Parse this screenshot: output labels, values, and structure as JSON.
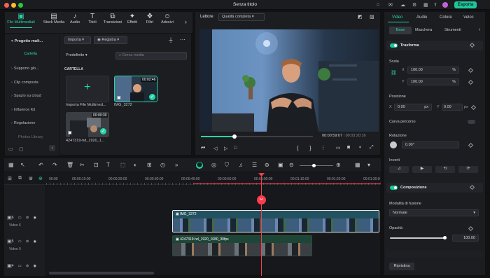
{
  "window": {
    "title": "Senza titolo",
    "export_label": "Esporta"
  },
  "toolbar_tabs": [
    {
      "label": "File Multimediali",
      "icon": "media-icon"
    },
    {
      "label": "Stock Media",
      "icon": "stock-media-icon"
    },
    {
      "label": "Audio",
      "icon": "music-note-icon"
    },
    {
      "label": "Titoli",
      "icon": "titles-icon"
    },
    {
      "label": "Transizioni",
      "icon": "transitions-icon"
    },
    {
      "label": "Effetti",
      "icon": "effects-icon"
    },
    {
      "label": "Filtri",
      "icon": "filters-icon"
    },
    {
      "label": "Adesivi",
      "icon": "stickers-icon"
    }
  ],
  "sidebar": {
    "items": [
      "Progetto mult...",
      "Cartella",
      "Supporto glo...",
      "Clip composta",
      "Spazio su cloud",
      "Influence Kit",
      "Regolazione",
      "Photos Library"
    ]
  },
  "media": {
    "import_label": "Importa",
    "record_label": "Registra",
    "sort_label": "Predefinito",
    "search_placeholder": "Cerca media",
    "folder_label": "CARTELLA",
    "items": [
      {
        "name": "Importa File Multimed...",
        "duration": ""
      },
      {
        "name": "IMG_3272",
        "duration": "00:02:46"
      },
      {
        "name": "4247319-hd_1920_1...",
        "duration": "00:00:39"
      }
    ]
  },
  "player": {
    "tab_label": "Lettore",
    "quality_label": "Qualità completa",
    "current_time": "00:00:59:07",
    "total_time": "00:03:20:16",
    "progress_fraction": 0.3
  },
  "inspector": {
    "tabs": [
      "Video",
      "Audio",
      "Colore",
      "Veloc"
    ],
    "subtabs": [
      "Base",
      "Maschera",
      "Strumenti"
    ],
    "transform_label": "Trasforma",
    "scale_label": "Scala",
    "scale_x_label": "X",
    "scale_x": "100.00",
    "scale_y_label": "Y",
    "scale_y": "100.00",
    "percent": "%",
    "position_label": "Posizione",
    "pos_x_label": "X",
    "pos_x": "0.00",
    "pos_y_label": "Y",
    "pos_y": "0.00",
    "px_unit": "px",
    "curve_label": "Curva percorso",
    "rotation_label": "Rotazione",
    "rotation_value": "0.00°",
    "flip_label": "Inverti",
    "composite_label": "Composizione",
    "blend_label": "Modalità di fusione",
    "blend_value": "Normale",
    "opacity_label": "Opacità",
    "opacity_value": "100.00",
    "reset_label": "Ripristina"
  },
  "timeline": {
    "ruler": [
      "00:00",
      "00:00:10:00",
      "00:00:20:00",
      "00:00:30:00",
      "00:00:40:00",
      "00:00:50:00",
      "00:01:00:00",
      "00:01:10:00",
      "00:01:20:00",
      "00:01:30:00"
    ],
    "tracks": [
      {
        "num": "6",
        "name": "Video 6"
      },
      {
        "num": "5",
        "name": "Video 5"
      },
      {
        "num": "4",
        "name": ""
      }
    ],
    "clips": [
      {
        "name": "IMG_3272"
      },
      {
        "name": "4247319-hd_1920_1080_30fps"
      }
    ]
  },
  "colors": {
    "accent": "#1ec79b",
    "playhead": "#ff3b4e",
    "background": "#111214"
  }
}
